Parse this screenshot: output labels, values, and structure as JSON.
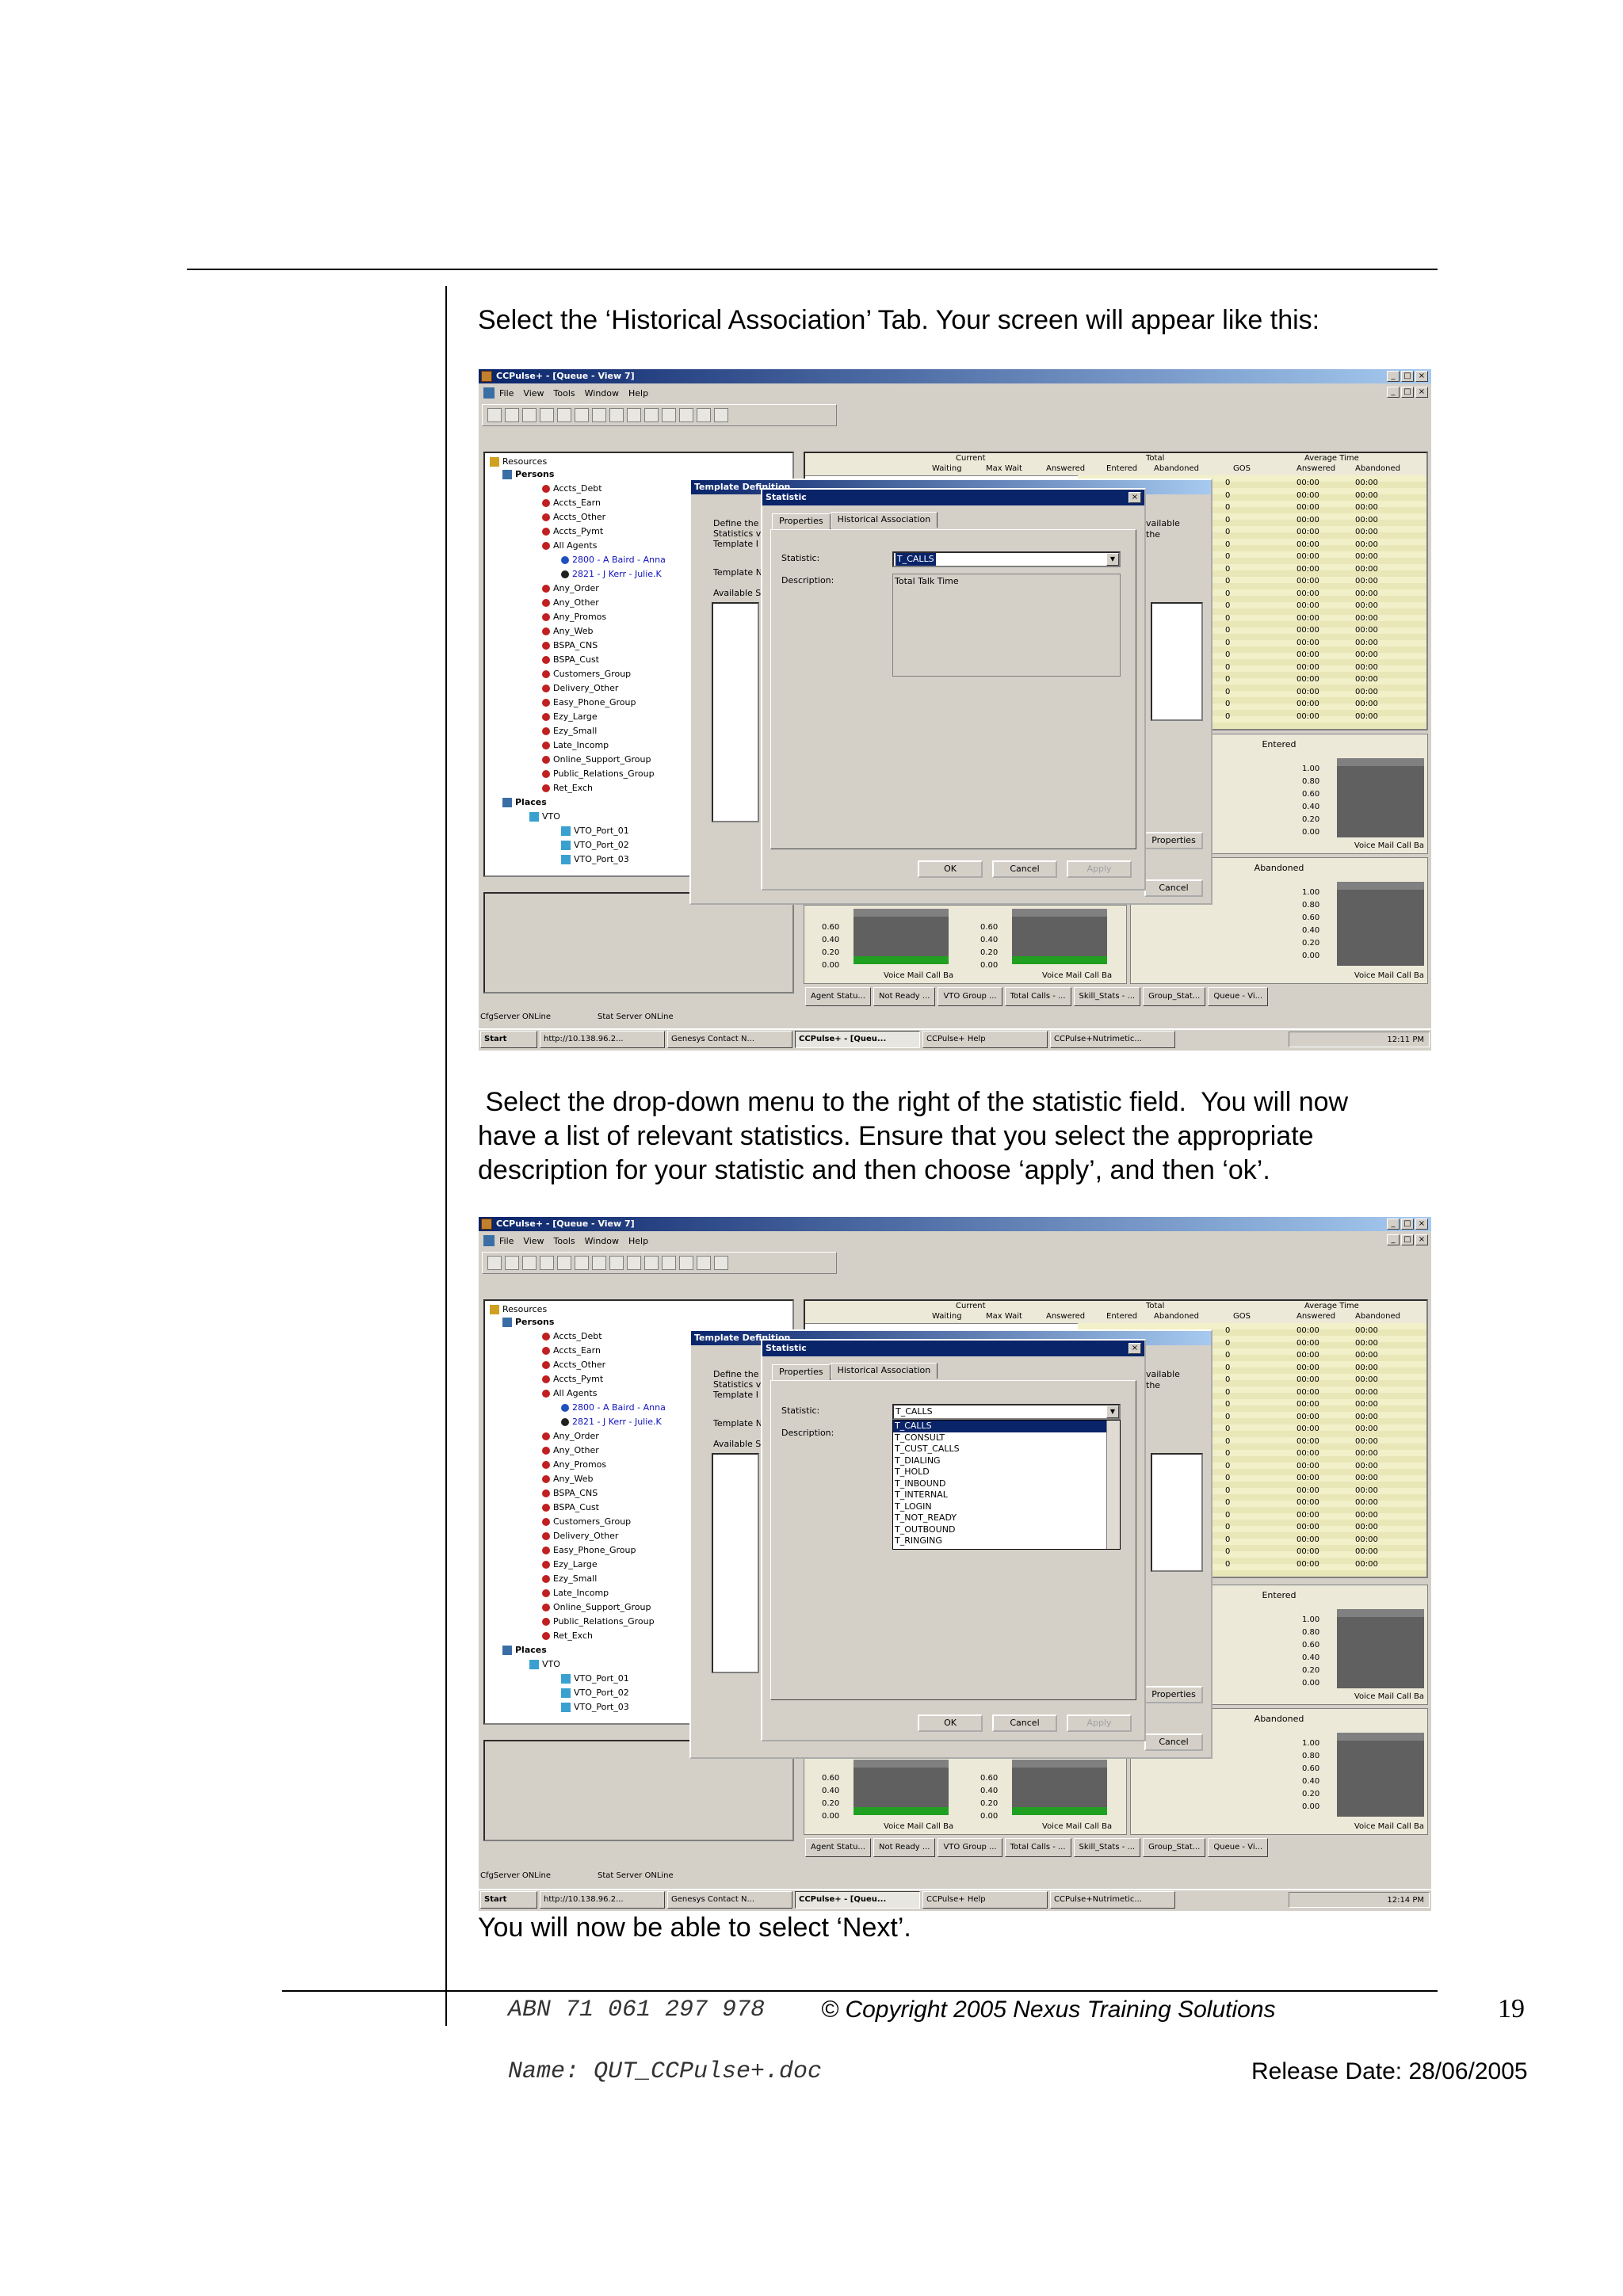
{
  "instructions": {
    "para1": "Select the ‘Historical Association’ Tab.  Your screen will appear like this:",
    "para2_line1": " Select the drop-down menu to the right of the statistic field.  You will now",
    "para2_line2": "have a list of relevant statistics.  Ensure that you select the appropriate",
    "para2_line3": "description for your statistic and then choose ‘apply’, and then ‘ok’.",
    "para3": "You will now be able to select ‘Next’."
  },
  "app": {
    "title": "CCPulse+ - [Queue - View 7]",
    "menu": [
      "File",
      "View",
      "Tools",
      "Window",
      "Help"
    ],
    "tree": {
      "root": "Resources",
      "persons": "Persons",
      "persons_items": [
        "Accts_Debt",
        "Accts_Earn",
        "Accts_Other",
        "Accts_Pymt",
        "All Agents"
      ],
      "agents": [
        "2800 - A Baird - Anna",
        "2821 - J Kerr - Julie.K"
      ],
      "groups": [
        "Any_Order",
        "Any_Other",
        "Any_Promos",
        "Any_Web",
        "BSPA_CNS",
        "BSPA_Cust",
        "Customers_Group",
        "Delivery_Other",
        "Easy_Phone_Group",
        "Ezy_Large",
        "Ezy_Small",
        "Late_Incomp",
        "Online_Support_Group",
        "Public_Relations_Group",
        "Ret_Exch"
      ],
      "places": "Places",
      "vto": "VTO",
      "ports": [
        "VTO_Port_01",
        "VTO_Port_02",
        "VTO_Port_03"
      ]
    },
    "grid": {
      "group_current": "Current",
      "group_total": "Total",
      "group_avg": "Average Time",
      "cols": [
        "Waiting",
        "Max Wait",
        "Answered",
        "Entered",
        "Abandoned",
        "GOS",
        "Answered",
        "Abandoned"
      ],
      "zero": "0",
      "time": "00:00"
    },
    "panels": {
      "entered": "Entered",
      "abandoned": "Abandoned",
      "ticks": [
        "1.00",
        "0.80",
        "0.60",
        "0.40",
        "0.20",
        "0.00"
      ],
      "xlabel": "Voice Mail Call Ba",
      "xlabel_short": "Mail Call Ba"
    },
    "template_dialog": {
      "title": "Template Definition",
      "define_lines": [
        "Define the",
        "Statistics v",
        "Template I"
      ],
      "template_label": "Template N",
      "available_label": "Available S",
      "available_text": "vailable",
      "the_text": "the",
      "properties_btn": "Properties",
      "cancel_btn": "Cancel"
    },
    "stat_dialog": {
      "title": "Statistic",
      "tab_properties": "Properties",
      "tab_hist": "Historical Association",
      "stat_label": "Statistic:",
      "desc_label": "Description:",
      "stat_value": "T_CALLS",
      "desc_value": "Total Talk Time",
      "ok": "OK",
      "cancel": "Cancel",
      "apply": "Apply",
      "dropdown": [
        "T_CALLS",
        "T_CONSULT",
        "T_CUST_CALLS",
        "T_DIALING",
        "T_HOLD",
        "T_INBOUND",
        "T_INTERNAL",
        "T_LOGIN",
        "T_NOT_READY",
        "T_OUTBOUND",
        "T_RINGING"
      ]
    },
    "status": {
      "cfg": "CfgServer ONLine",
      "stat": "Stat Server ONLine"
    },
    "view_tabs": [
      "Agent Statu...",
      "Not Ready ...",
      "VTO Group ...",
      "Total Calls - ...",
      "Skill_Stats - ...",
      "Group_Stat...",
      "Queue - Vi..."
    ],
    "taskbar": {
      "start": "Start",
      "items": [
        "http://10.138.96.2...",
        "Genesys Contact N...",
        "CCPulse+ - [Queu...",
        "CCPulse+ Help",
        "CCPulse+Nutrimetic..."
      ],
      "time1": "12:11 PM",
      "time2": "12:14 PM"
    }
  },
  "footer": {
    "abn": "ABN 71 061 297 978",
    "copyright": "© Copyright 2005 Nexus Training Solutions",
    "page": "19",
    "name": "Name: QUT_CCPulse+.doc",
    "release": "Release Date: 28/06/2005"
  }
}
